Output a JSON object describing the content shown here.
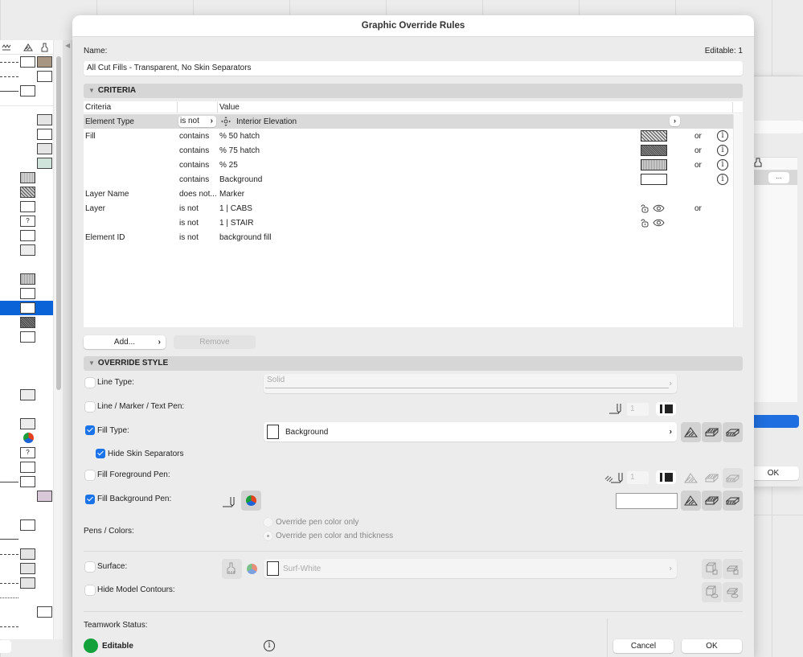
{
  "dialog": {
    "title": "Graphic Override Rules",
    "name_label": "Name:",
    "editable_count": "Editable: 1",
    "name_value": "All Cut Fills - Transparent, No Skin Separators"
  },
  "criteria": {
    "section_title": "CRITERIA",
    "columns": [
      "Criteria",
      "Value"
    ],
    "rows": [
      {
        "criteria": "Element Type",
        "operator": "is not",
        "value": "Interior Elevation",
        "icon": "element-type-icon",
        "selected": true
      },
      {
        "criteria": "Fill",
        "operator": "contains",
        "value": "%  50 hatch",
        "swatch": "50-hatch",
        "conjunction": "or",
        "info": true
      },
      {
        "criteria": "",
        "operator": "contains",
        "value": "%  75 hatch",
        "swatch": "75-hatch",
        "conjunction": "or",
        "info": true
      },
      {
        "criteria": "",
        "operator": "contains",
        "value": "%  25",
        "swatch": "25-percent",
        "conjunction": "or",
        "info": true
      },
      {
        "criteria": "",
        "operator": "contains",
        "value": "Background",
        "swatch": "background",
        "conjunction": "",
        "info": true
      },
      {
        "criteria": "Layer Name",
        "operator": "does not...",
        "value": "Marker"
      },
      {
        "criteria": "Layer",
        "operator": "is not",
        "value": "1 | CABS",
        "layer_icons": true,
        "conjunction": "or"
      },
      {
        "criteria": "",
        "operator": "is not",
        "value": "1 | STAIR",
        "layer_icons": true,
        "conjunction": ""
      },
      {
        "criteria": "Element ID",
        "operator": "is not",
        "value": "background fill"
      }
    ],
    "add_label": "Add...",
    "remove_label": "Remove"
  },
  "override": {
    "section_title": "OVERRIDE STYLE",
    "line_type": {
      "label": "Line Type:",
      "checked": false,
      "value": "Solid"
    },
    "line_pen": {
      "label": "Line / Marker / Text Pen:",
      "checked": false,
      "pen_value": "1"
    },
    "fill_type": {
      "label": "Fill Type:",
      "checked": true,
      "value": "Background"
    },
    "hide_skin": {
      "label": "Hide Skin Separators",
      "checked": true
    },
    "fill_fg_pen": {
      "label": "Fill Foreground Pen:",
      "checked": false,
      "pen_value": "1"
    },
    "fill_bg_pen": {
      "label": "Fill Background Pen:",
      "checked": true
    },
    "pens_colors": {
      "label": "Pens / Colors:",
      "options": [
        "Override pen color only",
        "Override pen color and thickness"
      ],
      "selected": 1
    },
    "surface": {
      "label": "Surface:",
      "checked": false,
      "value": "Surf-White"
    },
    "hide_contours": {
      "label": "Hide Model Contours:",
      "checked": false
    }
  },
  "teamwork": {
    "label": "Teamwork Status:",
    "status": "Editable",
    "status_color": "#12a13a"
  },
  "footer": {
    "cancel_label": "Cancel",
    "ok_label": "OK"
  },
  "background_dialog": {
    "dots_label": "...",
    "ok_label": "OK"
  },
  "colors": {
    "accent": "#1a73e8",
    "selection": "#0b63d8"
  }
}
